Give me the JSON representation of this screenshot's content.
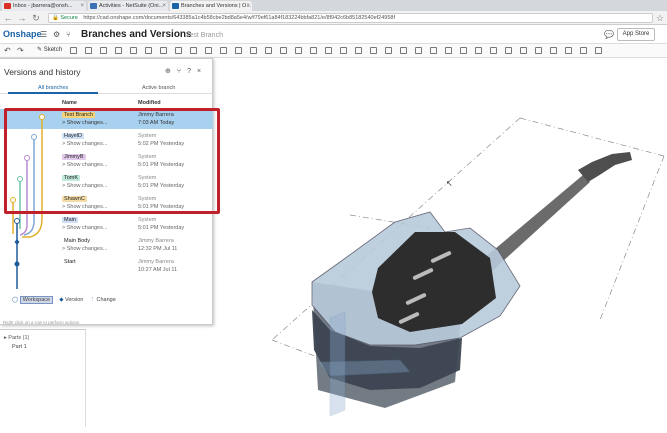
{
  "browser": {
    "tabs": [
      {
        "label": "Inbox - jbarrera@onsh...",
        "color": "#d93025"
      },
      {
        "label": "Activities - NetSuite (Oni...",
        "color": "#3b6fb6"
      },
      {
        "label": "Branches and Versions | O...",
        "color": "#1a63a6"
      }
    ],
    "secure_label": "Secure",
    "url": "https://cad.onshape.com/documents/643385a1c4b58cbe2bd8a5e4/w/f79ef61a84f183224bbfa821/e/8f942c6b85182540ef24958f"
  },
  "app": {
    "logo": "Onshape",
    "doc_title": "Branches and Versions",
    "branch": "Test Branch",
    "app_store": "App Store",
    "sketch_label": "Sketch"
  },
  "panel": {
    "title": "Versions and history",
    "tabs": [
      "All branches",
      "Active branch"
    ],
    "col_name": "Name",
    "col_modified": "Modified",
    "rows": [
      {
        "name": "Test Branch",
        "changes": "> Show changes...",
        "by": "Jimmy Barrera",
        "when": "7:03 AM Today",
        "tag": "#f5d27a"
      },
      {
        "name": "HayelD",
        "changes": "> Show changes...",
        "by": "System",
        "when": "5:02 PM Yesterday",
        "tag": "#cfe0f5"
      },
      {
        "name": "JimmyB",
        "changes": "> Show changes...",
        "by": "System",
        "when": "5:01 PM Yesterday",
        "tag": "#e3c9ec"
      },
      {
        "name": "TomK",
        "changes": "> Show changes...",
        "by": "System",
        "when": "5:01 PM Yesterday",
        "tag": "#bfe8d9"
      },
      {
        "name": "ShawnC",
        "changes": "> Show changes...",
        "by": "System",
        "when": "5:01 PM Yesterday",
        "tag": "#f3dca6"
      },
      {
        "name": "Main",
        "changes": "> Show changes...",
        "by": "System",
        "when": "5:01 PM Yesterday",
        "tag": "#cfe0f5"
      },
      {
        "name": "Main Body",
        "changes": "> Show changes...",
        "by": "Jimmy Barrera",
        "when": "12:32 PM Jul 11",
        "tag": ""
      },
      {
        "name": "Start",
        "changes": "",
        "by": "Jimmy Barrera",
        "when": "10:27 AM Jul 11",
        "tag": ""
      }
    ],
    "legend": {
      "workspace": "Workspace",
      "version": "Version",
      "change": "Change"
    },
    "hint": "Right click on a row to perform actions"
  },
  "parts": {
    "title": "Parts (1)",
    "item": "Part 1"
  },
  "colors": {
    "accent": "#1a63a6",
    "highlight": "#c0202a",
    "selected_row": "#a8d0ef"
  }
}
